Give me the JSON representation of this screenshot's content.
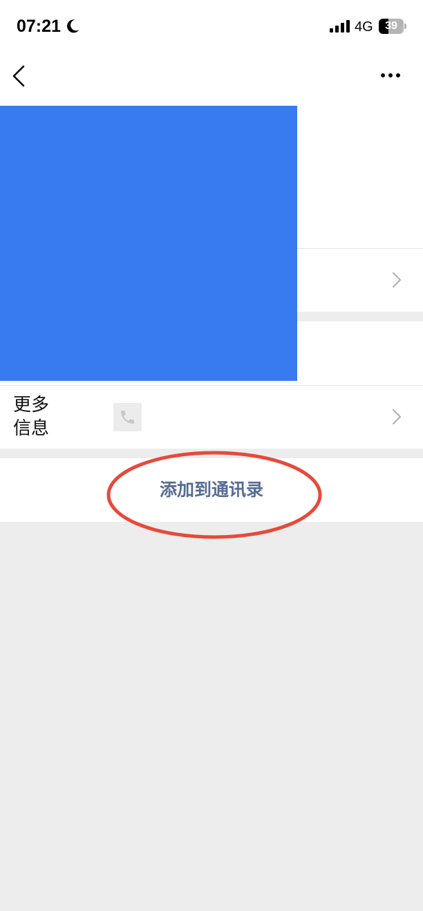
{
  "status_bar": {
    "time": "07:21",
    "network": "4G",
    "battery_level": 39,
    "battery_text": "39",
    "icons": [
      "moon-icon",
      "signal-icon",
      "battery-icon"
    ]
  },
  "nav": {
    "back_icon": "chevron-left-icon",
    "more_icon": "ellipsis-icon"
  },
  "more_info_row": {
    "label_line1": "更多",
    "label_line2": "信息",
    "thumb_icon": "phone-icon",
    "chevron_icon": "chevron-right-icon"
  },
  "add_contact": {
    "label": "添加到通讯录"
  },
  "colors": {
    "redaction": "#387bf0",
    "link": "#576b95",
    "annotation": "#e8493a",
    "background": "#ededed"
  }
}
